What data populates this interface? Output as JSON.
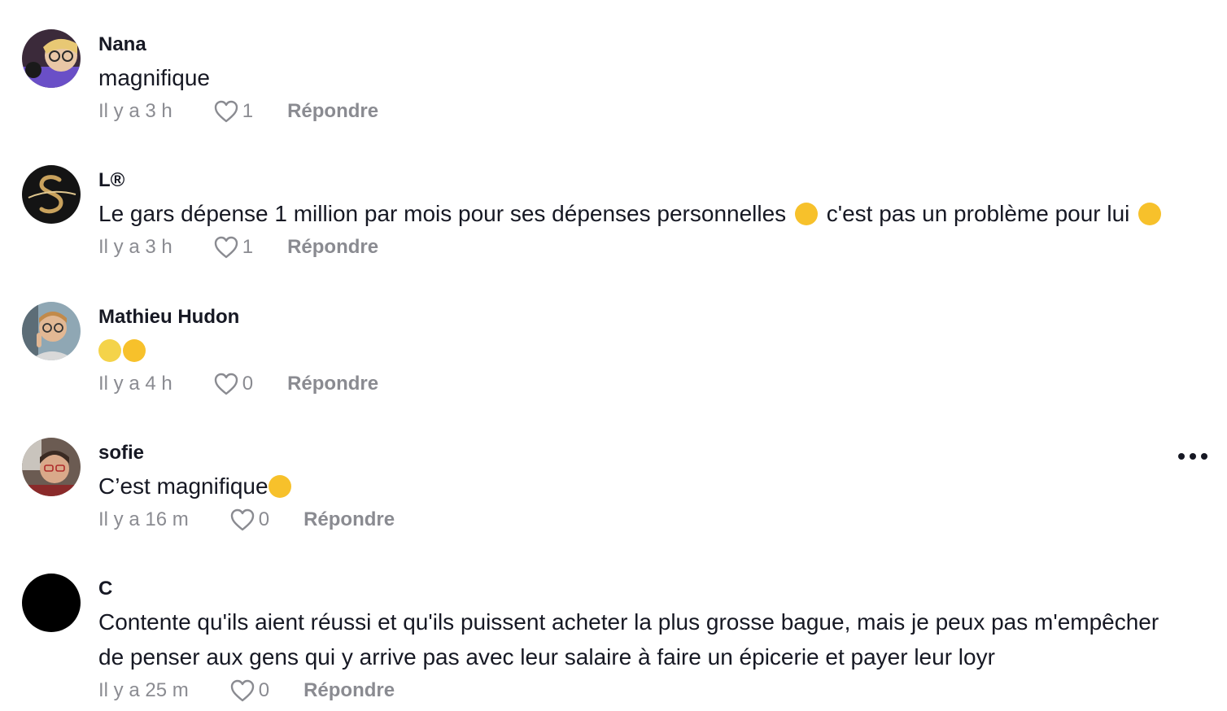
{
  "colors": {
    "primary_text": "#161823",
    "secondary_text": "#8a8b91",
    "background": "#ffffff"
  },
  "icons": {
    "like": "heart-outline-icon",
    "more": "more-horizontal-icon"
  },
  "comments": [
    {
      "username": "Nana",
      "text": "magnifique",
      "time": "Il y a 3 h",
      "likes": "1",
      "reply_label": "Répondre"
    },
    {
      "username": "L®",
      "text_parts": [
        "Le gars dépense 1 million par mois pour ses dépenses personnelles ",
        " c'est pas un problème pour lui "
      ],
      "emojis": [
        "grinning-sweat-emoji",
        "flushed-emoji"
      ],
      "time": "Il y a 3 h",
      "likes": "1",
      "reply_label": "Répondre"
    },
    {
      "username": "Mathieu Hudon",
      "emojis": [
        "scream-emoji",
        "star-struck-emoji"
      ],
      "time": "Il y a 4 h",
      "likes": "0",
      "reply_label": "Répondre"
    },
    {
      "username": "sofie",
      "text_parts": [
        "C’est magnifique"
      ],
      "emojis": [
        "smiling-face-with-hearts-emoji"
      ],
      "time": "Il y a 16 m",
      "likes": "0",
      "reply_label": "Répondre"
    },
    {
      "username": "C",
      "text": "Contente qu'ils aient réussi et qu'ils puissent acheter la plus grosse bague, mais je peux pas m'empêcher de penser aux gens qui y arrive pas avec leur salaire à faire un épicerie et payer leur loyr",
      "time": "Il y a 25 m",
      "likes": "0",
      "reply_label": "Répondre"
    }
  ]
}
